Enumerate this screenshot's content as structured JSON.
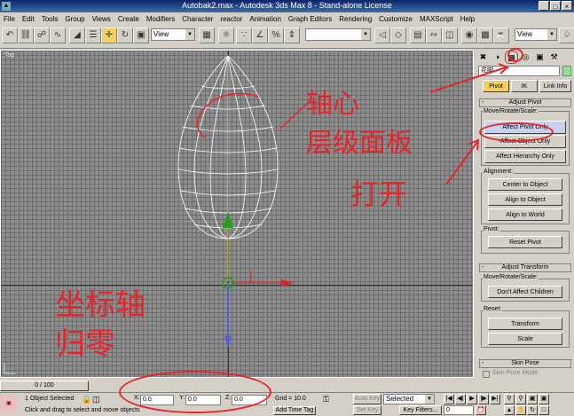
{
  "window": {
    "title": "Autobak2.max - Autodesk 3ds Max 8 - Stand-alone License"
  },
  "menu": [
    "File",
    "Edit",
    "Tools",
    "Group",
    "Views",
    "Create",
    "Modifiers",
    "Character",
    "reactor",
    "Animation",
    "Graph Editors",
    "Rendering",
    "Customize",
    "MAXScript",
    "Help"
  ],
  "toolbar": {
    "ref_coord": "View",
    "view_dropdown": "View"
  },
  "viewport": {
    "label": "Top"
  },
  "command_panel": {
    "object_name": "花脚",
    "tabs": {
      "pivot": "Pivot",
      "ik": "IK",
      "link_info": "Link Info"
    },
    "adjust_pivot": {
      "title": "Adjust Pivot",
      "move_label": "Move/Rotate/Scale:",
      "affect_pivot_only": "Affect Pivot Only",
      "affect_object_only": "Affect Object Only",
      "affect_hierarchy_only": "Affect Hierarchy Only",
      "alignment_label": "Alignment:",
      "center_to_object": "Center to Object",
      "align_to_object": "Align to Object",
      "align_to_world": "Align to World",
      "pivot_label": "Pivot:",
      "reset_pivot": "Reset Pivot"
    },
    "adjust_transform": {
      "title": "Adjust Transform",
      "move_label": "Move/Rotate/Scale:",
      "dont_affect_children": "Don't Affect Children",
      "reset_label": "Reset:",
      "transform": "Transform",
      "scale": "Scale"
    },
    "skin_pose": {
      "title": "Skin Pose",
      "skin_pose_mode": "Skin Pose Mode"
    }
  },
  "timeline": {
    "frame": "0 / 100"
  },
  "status": {
    "selection": "1 Object Selected",
    "prompt": "Click and drag to select and move objects",
    "x_label": "X:",
    "x_value": "0.0",
    "y_label": "Y:",
    "y_value": "0.0",
    "z_label": "Z:",
    "z_value": "0.0",
    "grid": "Grid = 10.0",
    "auto_key": "Auto Key",
    "set_key": "Set Key",
    "selected_dropdown": "Selected",
    "key_filters": "Key Filters...",
    "add_time_tag": "Add Time Tag",
    "frame_value": "0"
  },
  "annotations": {
    "pivot_panel_1": "轴心",
    "pivot_panel_2": "层级面板",
    "open": "打开",
    "axis_1": "坐标轴",
    "axis_2": "归零"
  },
  "colors": {
    "annotation_red": "#e8232a",
    "viewport_grid": "#8e8e8e",
    "selected_button": "#c8d0f0"
  }
}
